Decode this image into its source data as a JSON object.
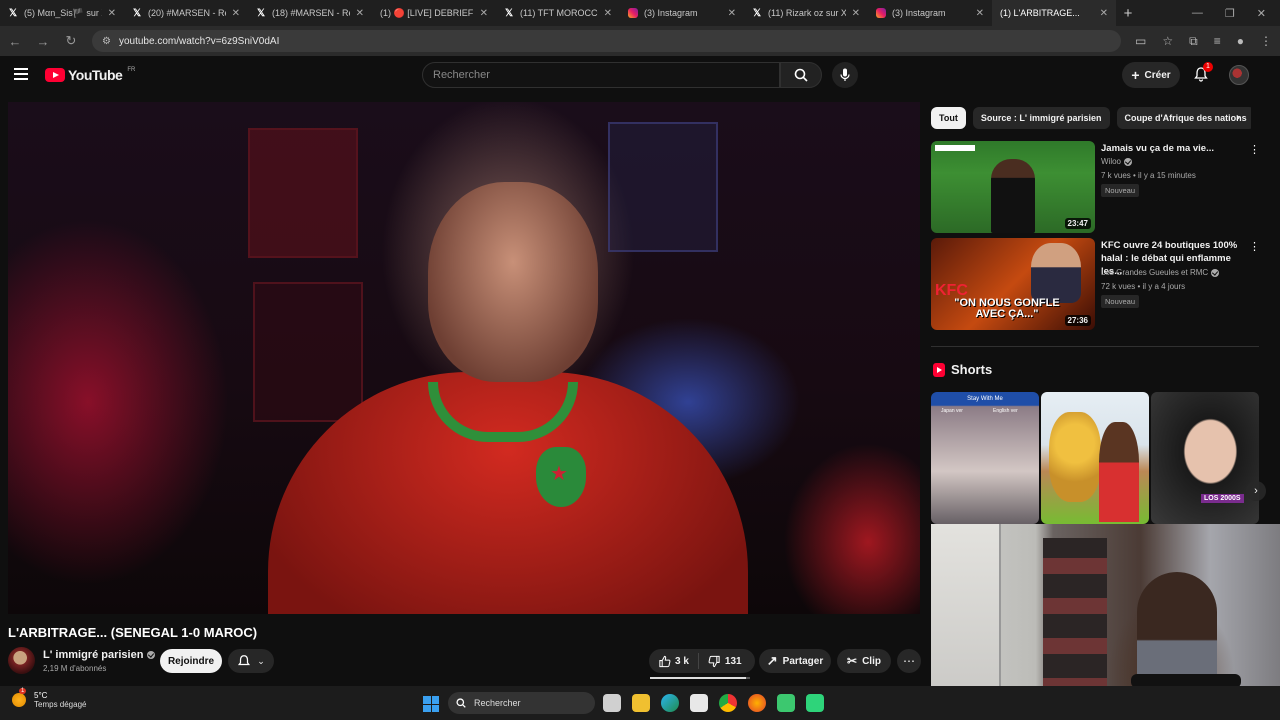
{
  "browser": {
    "tabs": [
      {
        "title": "(5) Mαn_Sis🏴 sur X :",
        "icon": "x-icon"
      },
      {
        "title": "(20) #MARSEN - Rech",
        "icon": "x-icon"
      },
      {
        "title": "(18) #MARSEN - Rech",
        "icon": "x-icon"
      },
      {
        "title": "(1) 🔴 [LIVE] DEBRIEF",
        "icon": "youtube-icon"
      },
      {
        "title": "(11) TFT MOROCCO :",
        "icon": "x-icon"
      },
      {
        "title": "(3) Instagram",
        "icon": "instagram-icon"
      },
      {
        "title": "(11) Rizark oz sur X :",
        "icon": "x-icon"
      },
      {
        "title": "(3) Instagram",
        "icon": "instagram-icon"
      },
      {
        "title": "(1) L'ARBITRAGE...",
        "icon": "youtube-icon"
      }
    ],
    "url": "youtube.com/watch?v=6z9SniV0dAI"
  },
  "masthead": {
    "logo_text": "YouTube",
    "country": "FR",
    "search_placeholder": "Rechercher",
    "create_label": "Créer",
    "notif_count": "1"
  },
  "video": {
    "title": "L'ARBITRAGE... (SENEGAL 1-0 MAROC)",
    "channel": "L' immigré parisien",
    "subscribers": "2,19 M d'abonnés",
    "join_label": "Rejoindre",
    "likes": "3 k",
    "dislikes": "131",
    "share_label": "Partager",
    "clip_label": "Clip",
    "like_ratio": 0.96
  },
  "chips": [
    "Tout",
    "Source : L' immigré parisien",
    "Coupe d'Afrique des nations"
  ],
  "recommendations": [
    {
      "title": "Jamais vu ça de ma vie...",
      "channel": "Wiloo",
      "meta": "7 k vues • il y a 15 minutes",
      "badge": "Nouveau",
      "duration": "23:47"
    },
    {
      "title": "KFC ouvre 24 boutiques 100% halal : le débat qui enflamme les...",
      "channel": "Les Grandes Gueules et RMC",
      "meta": "72 k vues • il y a 4 jours",
      "badge": "Nouveau",
      "duration": "27:36",
      "thumb_logo": "KFC",
      "thumb_caption": "\"ON NOUS GONFLE AVEC ÇA...\""
    }
  ],
  "shorts": {
    "heading": "Shorts",
    "items": [
      {
        "caption": "Stay With Me",
        "sub_left": "Japan ver",
        "sub_right": "English ver"
      },
      {
        "caption": ""
      },
      {
        "caption": "LOS 2000S"
      }
    ]
  },
  "taskbar": {
    "temperature": "5°C",
    "weather": "Temps dégagé",
    "weather_badge": "1",
    "search_label": "Rechercher"
  },
  "colors": {
    "brand": "#ff0033",
    "background": "#0f0f0f",
    "chip_bg": "#272727"
  }
}
